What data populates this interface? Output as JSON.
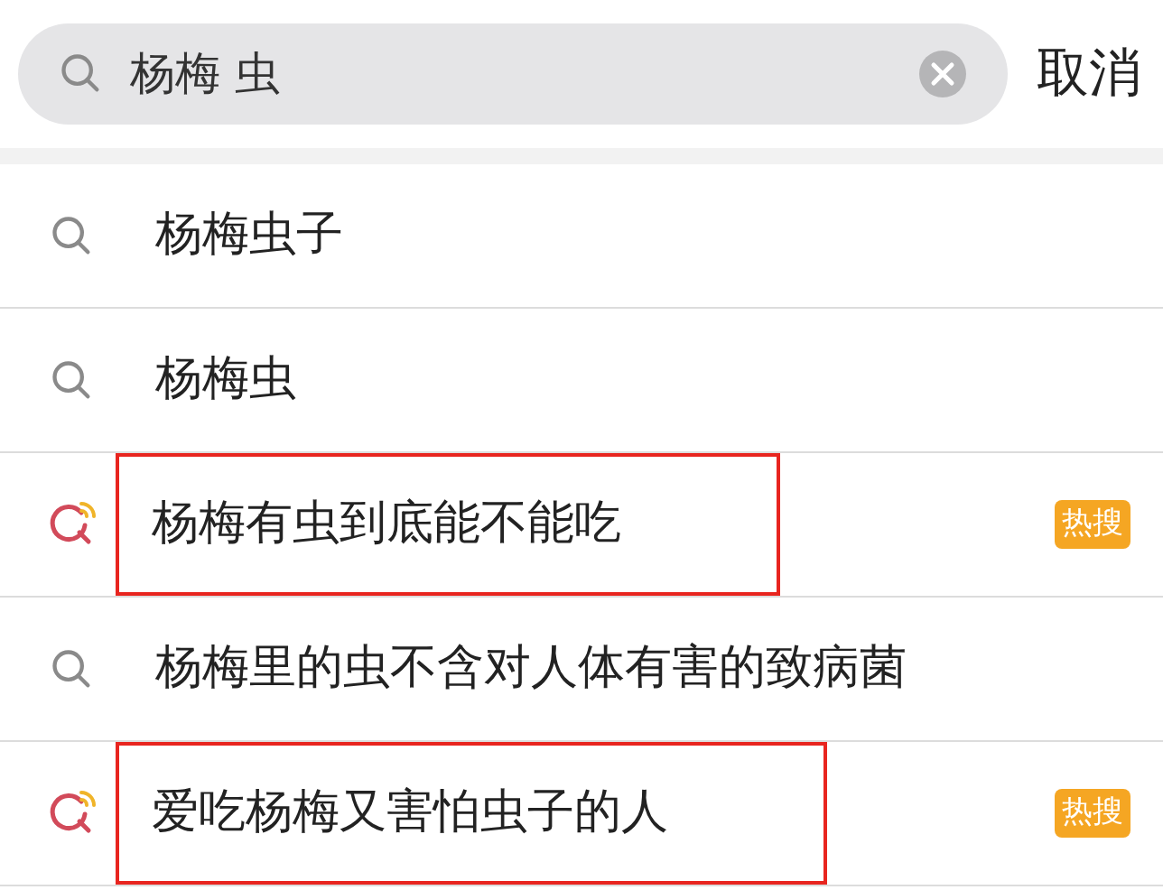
{
  "search": {
    "value": "杨梅 虫",
    "cancel": "取消"
  },
  "suggestions": [
    {
      "text": "杨梅虫子",
      "kind": "normal",
      "highlighted": false
    },
    {
      "text": "杨梅虫",
      "kind": "normal",
      "highlighted": false
    },
    {
      "text": "杨梅有虫到底能不能吃",
      "kind": "hot",
      "badge": "热搜",
      "highlighted": true
    },
    {
      "text": "杨梅里的虫不含对人体有害的致病菌",
      "kind": "normal",
      "highlighted": false
    },
    {
      "text": "爱吃杨梅又害怕虫子的人",
      "kind": "hot",
      "badge": "热搜",
      "highlighted": true
    }
  ]
}
